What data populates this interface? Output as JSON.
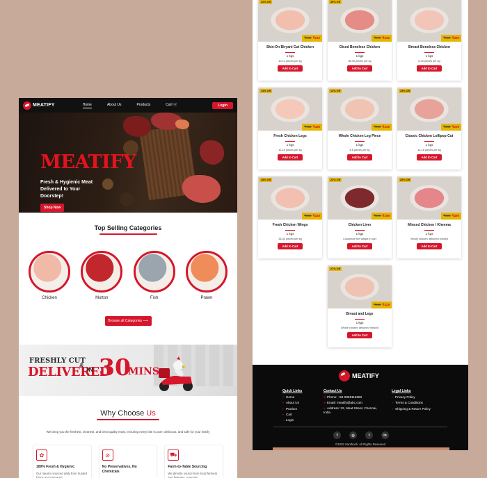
{
  "nav": {
    "brand": "MEATIFY",
    "links": [
      "Home",
      "About Us",
      "Products",
      "Cart"
    ],
    "login": "Login"
  },
  "hero": {
    "title": "MEATIFY",
    "subtitle": "Fresh & Hygienic Meat Delivered to Your Doorstep!",
    "cta": "Shop Now"
  },
  "categories": {
    "title": "Top Selling Categories",
    "items": [
      {
        "label": "Chicken",
        "color": "#f0b9a8"
      },
      {
        "label": "Mutton",
        "color": "#c2272d"
      },
      {
        "label": "Fish",
        "color": "#9aa5ad"
      },
      {
        "label": "Prawn",
        "color": "#f08b5a"
      }
    ],
    "browse": "Browse all Categories"
  },
  "banner": {
    "line1": "FRESHLY CUT",
    "amp": "&",
    "line2": "DELIVERED",
    "in": "IN",
    "number": "30",
    "unit": "MINS"
  },
  "why": {
    "title_a": "Why Choose",
    "title_b": "Us",
    "intro": "We bring you the freshest, cleanest, and best-quality meat, ensuring every bite is pure, delicious, and safe for your family",
    "features": [
      {
        "title": "100% Fresh & Hygienic",
        "text": "Our meat is sourced daily from trusted farms and prepared",
        "icon": "leaf-icon"
      },
      {
        "title": "No Preservatives, No Chemicals",
        "text": "",
        "icon": "no-chemical-icon"
      },
      {
        "title": "Farm-to-Table Sourcing",
        "text": "We directly source from local farmers and fisheries, ensuring",
        "icon": "truck-icon"
      }
    ]
  },
  "products": [
    {
      "off": "22% Off",
      "name": "Skin-On Biryani Cut Chicken",
      "kg": "1 kgs",
      "desc": "10-12 pieces per kg",
      "old": "₹289",
      "price": "₹219",
      "color": "#f2bfae"
    },
    {
      "off": "30% Off",
      "name": "Diced Boneless Chicken",
      "kg": "1 kgs",
      "desc": "35-40 pieces per kg",
      "old": "₹599",
      "price": "₹440",
      "color": "#e58c86"
    },
    {
      "off": "",
      "name": "Breast Boneless Chicken",
      "kg": "1 kgs",
      "desc": "8-10 pieces per kg",
      "old": "₹599",
      "price": "₹499",
      "color": "#f1c6b8"
    },
    {
      "off": "13% Off",
      "name": "Fresh Chicken Legs",
      "kg": "1 kgs",
      "desc": "12-15 pieces per kg",
      "old": "₹489",
      "price": "₹439",
      "color": "#f4c9ba"
    },
    {
      "off": "12% Off",
      "name": "Whole Chicken Leg Piece",
      "kg": "1 kgs",
      "desc": "4-6 pieces per kg",
      "old": "₹499",
      "price": "₹439",
      "color": "#f0c3b3"
    },
    {
      "off": "15% Off",
      "name": "Classic Chicken Lollipop Cut",
      "kg": "1 kgs",
      "desc": "14-16 pieces per kg",
      "old": "₹239",
      "price": "₹209",
      "color": "#e7a39a"
    },
    {
      "off": "18% Off",
      "name": "Fresh Chicken Wings",
      "kg": "1 kgs",
      "desc": "35-40 pieces per kg",
      "old": "₹299",
      "price": "₹249",
      "color": "#f1c0b0"
    },
    {
      "off": "22% Off",
      "name": "Chicken Liver",
      "kg": "1 kgs",
      "desc": "Customize the weight in cart",
      "old": "₹249",
      "price": "₹199",
      "color": "#7e2a2c"
    },
    {
      "off": "20% Off",
      "name": "Minced Chicken / Kheema",
      "kg": "1 kgs",
      "desc": "Whole chicken deboned minced",
      "old": "₹599",
      "price": "₹499",
      "color": "#e4868a"
    },
    {
      "off": "27% Off",
      "name": "Breast and Legs",
      "kg": "1 kgs",
      "desc": "Whole chicken deboned minced",
      "old": "₹599",
      "price": "₹429",
      "color": "#f0c2b3"
    }
  ],
  "add_label": "Add to Cart",
  "footer": {
    "brand": "MEATIFY",
    "quick_title": "Quick Links",
    "quick": [
      "Home",
      "About Us",
      "Product",
      "Cart",
      "Login"
    ],
    "contact_title": "Contact Us",
    "contact": [
      "Phone: +91 8058115583",
      "Email: meatify@abc.com",
      "Address: 32, Meat Street, Chennai, India"
    ],
    "legal_title": "Legal Links",
    "legal": [
      "Privacy Policy",
      "Terms & Conditions",
      "Shipping & Return Policy"
    ],
    "socials": [
      "f",
      "◎",
      "t",
      "in"
    ],
    "copyright": "©2025 Santhosh. All Rights Reserved"
  }
}
